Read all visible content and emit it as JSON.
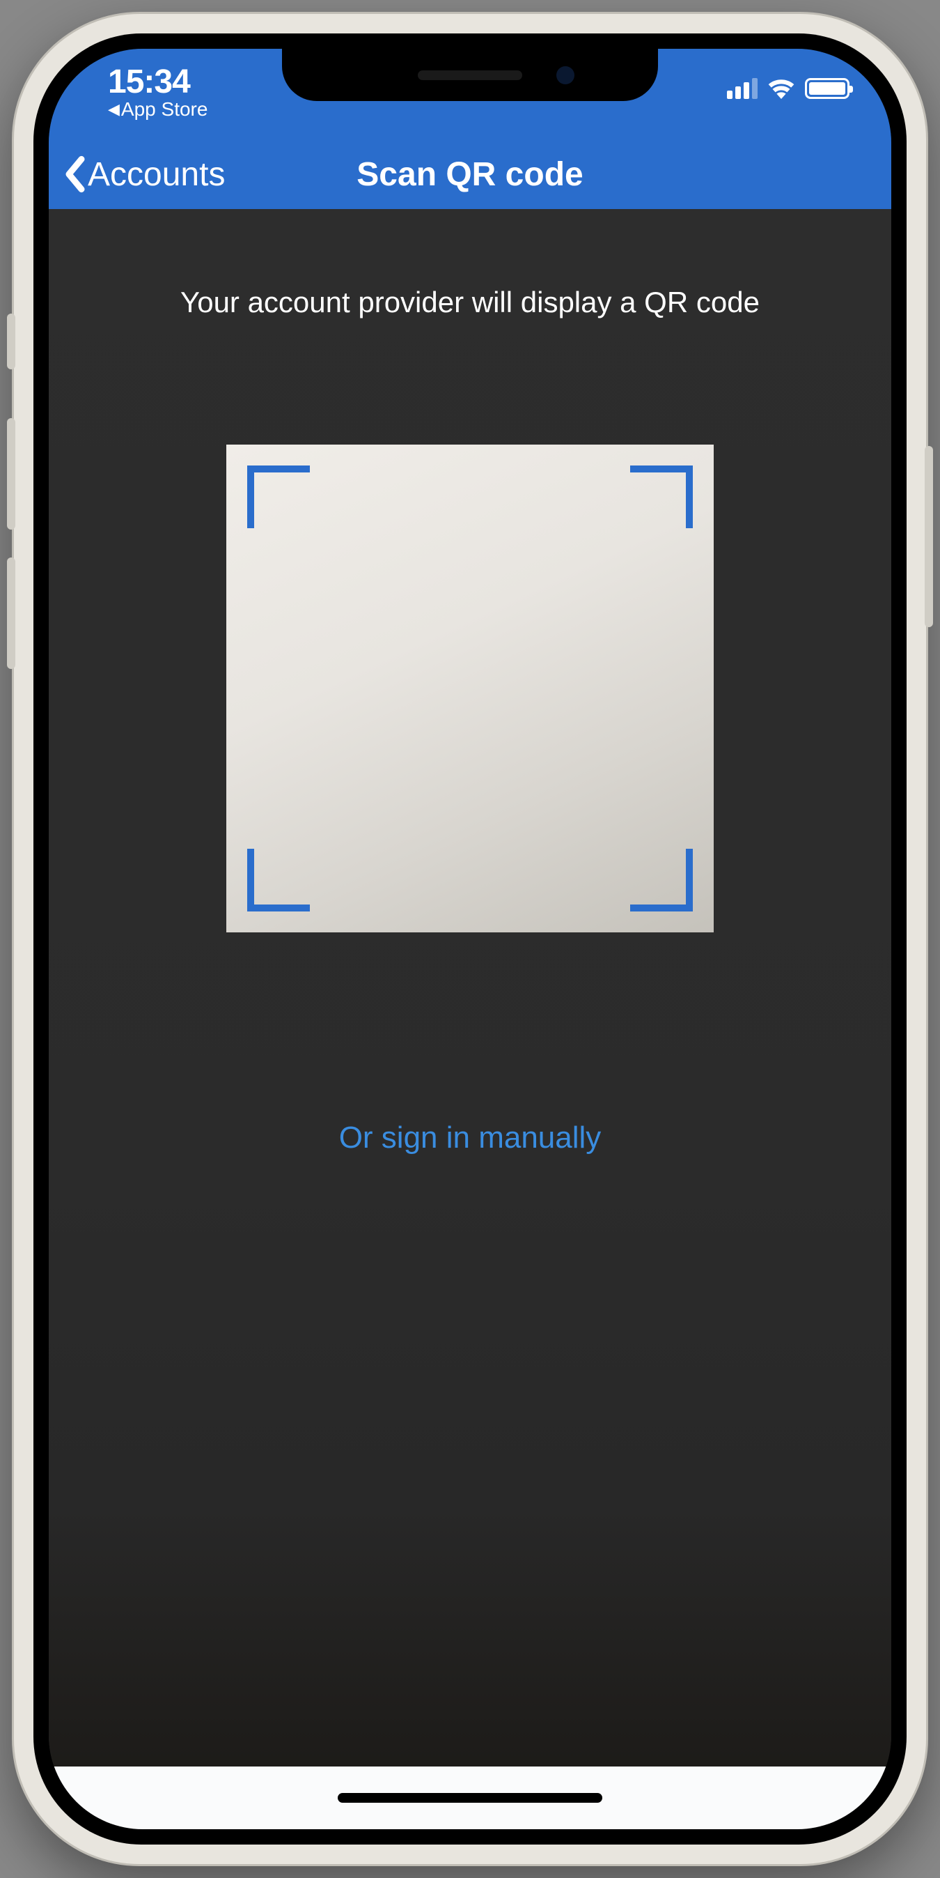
{
  "statusBar": {
    "time": "15:34",
    "backToApp": "App Store"
  },
  "navBar": {
    "backLabel": "Accounts",
    "title": "Scan QR code"
  },
  "content": {
    "instruction": "Your account provider will display a QR code",
    "manualLink": "Or sign in manually"
  }
}
